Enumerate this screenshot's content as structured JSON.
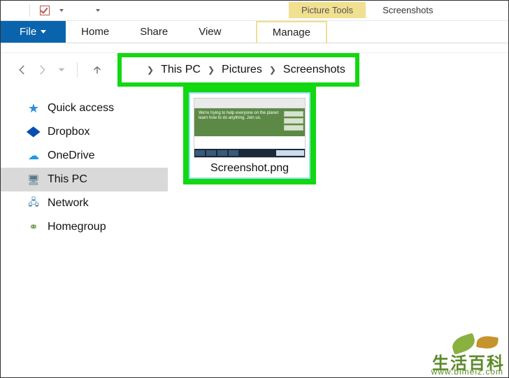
{
  "titlebar": {
    "contextual_label": "Picture Tools",
    "window_title": "Screenshots"
  },
  "ribbon": {
    "file": "File",
    "home": "Home",
    "share": "Share",
    "view": "View",
    "manage": "Manage"
  },
  "breadcrumb": {
    "seg1": "This PC",
    "seg2": "Pictures",
    "seg3": "Screenshots"
  },
  "sidebar": {
    "items": [
      {
        "label": "Quick access"
      },
      {
        "label": "Dropbox"
      },
      {
        "label": "OneDrive"
      },
      {
        "label": "This PC"
      },
      {
        "label": "Network"
      },
      {
        "label": "Homegroup"
      }
    ]
  },
  "content": {
    "file_name": "Screenshot.png",
    "thumb_hero_line1": "We're trying to help everyone on the planet",
    "thumb_hero_line2": "learn how to do anything. Join us."
  },
  "highlight_color": "#11d811",
  "watermark": {
    "chars": "生活百科",
    "url": "www.bimeiz.com"
  }
}
